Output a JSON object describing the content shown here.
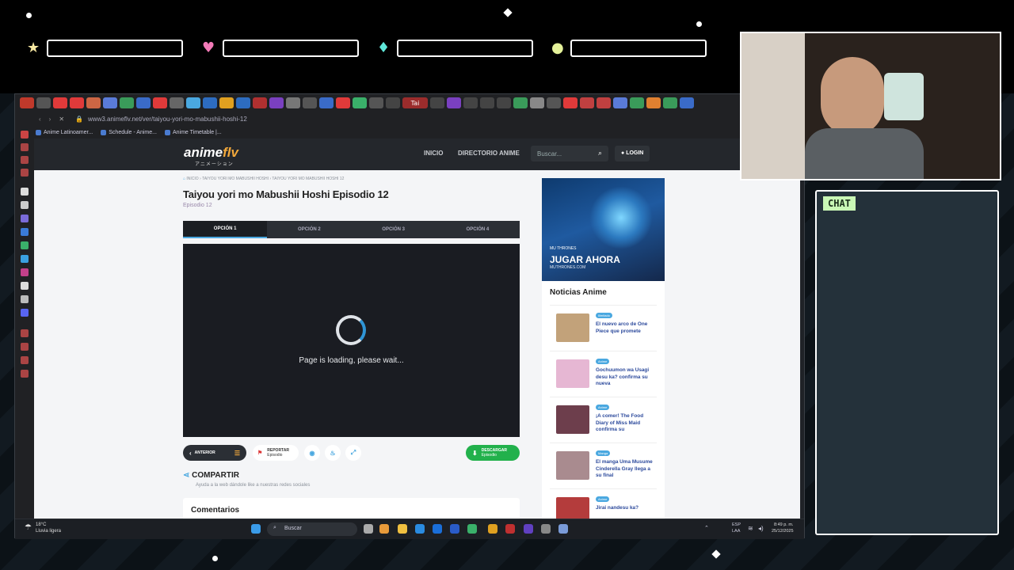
{
  "overlay": {
    "chat_label": "CHAT"
  },
  "browser": {
    "active_tab_label": "Tai",
    "url": "www3.animeflv.net/ver/taiyou-yori-mo-mabushii-hoshi-12",
    "bookmarks": [
      "Anime Latinoamer...",
      "Schedule - Anime...",
      "Anime Timetable |..."
    ]
  },
  "site": {
    "logo_main": "anime",
    "logo_accent": "flv",
    "logo_sub": "アニメーション",
    "nav": [
      "INICIO",
      "DIRECTORIO ANIME"
    ],
    "search_placeholder": "Buscar...",
    "login_label": "LOGIN",
    "breadcrumb": [
      "INICIO",
      "TAIYOU YORI MO MABUSHII HOSHI",
      "TAIYOU YORI MO MABUSHII HOSHI 12"
    ],
    "episode_title": "Taiyou yori mo Mabushii Hoshi Episodio 12",
    "episode_sub": "Episodio 12",
    "options": [
      "OPCIÓN 1",
      "OPCIÓN 2",
      "OPCIÓN 3",
      "OPCIÓN 4"
    ],
    "loading_text": "Page is loading, please wait...",
    "controls": {
      "prev_label": "ANTERIOR",
      "report_label": "REPORTAR",
      "report_sub": "Episodio",
      "download_label": "DESCARGAR",
      "download_sub": "Episodio"
    },
    "share_title": "COMPARTIR",
    "share_sub": "Ayuda a la web dándole like a nuestras redes sociales",
    "comments_title": "Comentarios",
    "ad": {
      "tag": "MU THRONES",
      "cta": "JUGAR AHORA",
      "domain": "MUTHRONES.COM"
    },
    "news_title": "Noticias Anime",
    "news": [
      {
        "category": "Ilimitado",
        "text": "El nuevo arco de One Piece que promete",
        "thumb": "#c2a27a"
      },
      {
        "category": "Anime",
        "text": "Gochuumon wa Usagi desu ka? confirma su nueva",
        "thumb": "#e6b7d3"
      },
      {
        "category": "Anime",
        "text": "¡A comer! The Food Diary of Miss Maid confirma su",
        "thumb": "#6d3e4c"
      },
      {
        "category": "Manga",
        "text": "El manga Uma Musume Cinderella Gray llega a su final",
        "thumb": "#a98b8f"
      },
      {
        "category": "Anime",
        "text": "Jirai nandesu ka?",
        "thumb": "#b43c3c"
      }
    ]
  },
  "taskbar": {
    "weather_temp": "18°C",
    "weather_desc": "Lluvia ligera",
    "search_label": "Buscar",
    "lang": "ESP",
    "lang_sub": "LAA",
    "time": "8:49 p. m.",
    "date": "25/12/2025"
  }
}
